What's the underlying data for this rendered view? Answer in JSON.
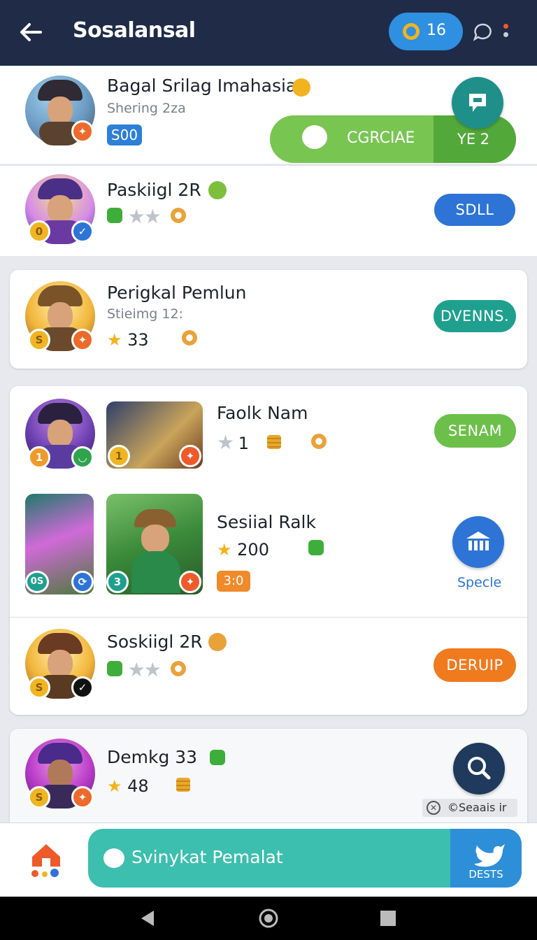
{
  "header": {
    "title": "Sosalansal",
    "coins": "16"
  },
  "rows": [
    {
      "name": "Bagal Srilag Imahasia",
      "sub": "Shering 2za",
      "tag": "S00"
    },
    {
      "name": "Paskiigl 2R",
      "button": "SDLL"
    },
    {
      "name": "Perigkal Pemlun",
      "sub": "Stieimg 12:",
      "stat": "33",
      "button": "DVENNS."
    },
    {
      "name": "Faolk Nam",
      "stat": "1",
      "button": "SENAM"
    },
    {
      "name": "Sesiial Ralk",
      "stat": "200",
      "tag": "3:0",
      "action_label": "Specle",
      "badge_left": "0S",
      "badge_right": "3"
    },
    {
      "name": "Soskiigl 2R",
      "button": "DERUIP"
    },
    {
      "name": "Demkg 33",
      "stat": "48",
      "search_label": "©Seaais ir"
    }
  ],
  "badges": {
    "row1": "0",
    "row3": "S",
    "row4_a": "1",
    "row4_b": "1",
    "row6": "S",
    "row7": "S"
  },
  "popup": {
    "label": "CGRCIAE",
    "right": "YE 2"
  },
  "bottom": {
    "chat_label": "Svinykat Pemalat",
    "right_label": "DESTS"
  },
  "colors": {
    "green": "#6cc04a",
    "blue": "#2d74d6",
    "teal": "#1fa08f",
    "orange": "#f07a1e",
    "navy": "#1f2b47"
  }
}
